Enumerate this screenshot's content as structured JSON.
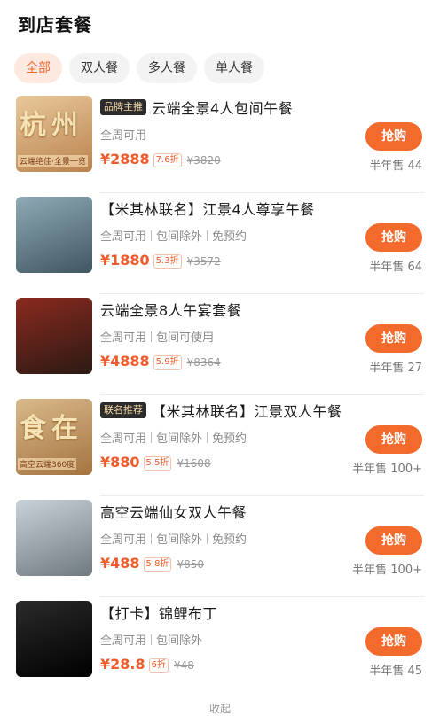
{
  "header": {
    "title": "到店套餐"
  },
  "tabs": [
    "全部",
    "双人餐",
    "多人餐",
    "单人餐"
  ],
  "items": [
    {
      "badge": "品牌主推",
      "name": "云端全景4人包间午餐",
      "tags": [
        "全周可用"
      ],
      "price": "¥2888",
      "discount": "7.6折",
      "original": "¥3820",
      "buy": "抢购",
      "sold": "半年售 44",
      "thumb_text": "杭州",
      "thumb_sub": "云端绝佳·全景一览",
      "thumb_colors": [
        "#e9c89a",
        "#b9834e"
      ]
    },
    {
      "badge": "",
      "name": "【米其林联名】江景4人尊享午餐",
      "tags": [
        "全周可用",
        "包间除外",
        "免预约"
      ],
      "price": "¥1880",
      "discount": "5.3折",
      "original": "¥3572",
      "buy": "抢购",
      "sold": "半年售 64",
      "thumb_text": "",
      "thumb_sub": "",
      "thumb_colors": [
        "#8fa9b6",
        "#3f5762"
      ]
    },
    {
      "badge": "",
      "name": "云端全景8人午宴套餐",
      "tags": [
        "全周可用",
        "包间可使用"
      ],
      "price": "¥4888",
      "discount": "5.9折",
      "original": "¥8364",
      "buy": "抢购",
      "sold": "半年售 27",
      "thumb_text": "",
      "thumb_sub": "",
      "thumb_colors": [
        "#8b2a1e",
        "#2a1a14"
      ]
    },
    {
      "badge": "联名推荐",
      "name": "【米其林联名】江景双人午餐",
      "tags": [
        "全周可用",
        "包间除外",
        "免预约"
      ],
      "price": "¥880",
      "discount": "5.5折",
      "original": "¥1608",
      "buy": "抢购",
      "sold": "半年售 100+",
      "thumb_text": "食在",
      "thumb_sub": "高空云端360度",
      "thumb_colors": [
        "#d9b98a",
        "#a47440"
      ]
    },
    {
      "badge": "",
      "name": "高空云端仙女双人午餐",
      "tags": [
        "全周可用",
        "包间除外",
        "免预约"
      ],
      "price": "¥488",
      "discount": "5.8折",
      "original": "¥850",
      "buy": "抢购",
      "sold": "半年售 100+",
      "thumb_text": "",
      "thumb_sub": "",
      "thumb_colors": [
        "#c9d2d8",
        "#6f7a80"
      ]
    },
    {
      "badge": "",
      "name": "【打卡】锦鲤布丁",
      "tags": [
        "全周可用",
        "包间除外"
      ],
      "price": "¥28.8",
      "discount": "6折",
      "original": "¥48",
      "buy": "抢购",
      "sold": "半年售 45",
      "thumb_text": "",
      "thumb_sub": "",
      "thumb_colors": [
        "#2a2a2a",
        "#000000"
      ]
    }
  ],
  "bottom_hint": "收起"
}
